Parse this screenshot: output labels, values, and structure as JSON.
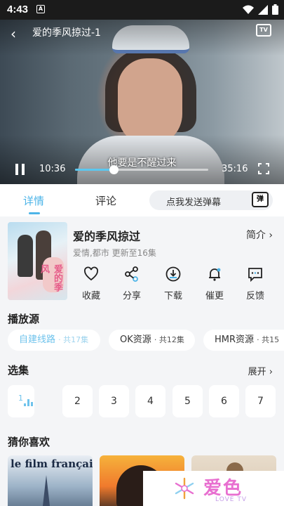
{
  "status_bar": {
    "time": "4:43",
    "badge": "A"
  },
  "player": {
    "title": "爱的季风掠过-1",
    "subtitle": "他要是不醒过来",
    "current_time": "10:36",
    "duration": "35:16",
    "progress": 0.29,
    "cast_label": "TV"
  },
  "tabs": {
    "details": "详情",
    "comments": "评论"
  },
  "danmu": {
    "placeholder": "点我发送弹幕",
    "icon_label": "弹"
  },
  "show": {
    "title": "爱的季风掠过",
    "intro": "简介",
    "genres": "爱情,都市",
    "update": "更新至16集",
    "poster_text": "爱的季风"
  },
  "actions": [
    {
      "label": "收藏",
      "icon": "heart-icon"
    },
    {
      "label": "分享",
      "icon": "share-icon"
    },
    {
      "label": "下载",
      "icon": "download-icon"
    },
    {
      "label": "催更",
      "icon": "bell-icon"
    },
    {
      "label": "反馈",
      "icon": "feedback-icon"
    }
  ],
  "sources": {
    "title": "播放源",
    "items": [
      {
        "name": "自建线路",
        "count": "· 共17集",
        "active": true
      },
      {
        "name": "OK资源",
        "count": "· 共12集",
        "active": false
      },
      {
        "name": "HMR资源",
        "count": "· 共15",
        "active": false
      }
    ]
  },
  "episodes": {
    "title": "选集",
    "expand": "展开",
    "items": [
      "1",
      "2",
      "3",
      "4",
      "5",
      "6",
      "7"
    ],
    "active_index": 0
  },
  "recommend": {
    "title": "猜你喜欢",
    "items": [
      {
        "title": "le film français"
      },
      {
        "title": ""
      },
      {
        "title": ""
      }
    ]
  },
  "watermark": {
    "zh": "爱色",
    "en": "LOVE TV"
  },
  "colors": {
    "accent": "#4cb4e8",
    "light_accent": "#6fc3ec",
    "logo_pink": "#e86fd0"
  }
}
